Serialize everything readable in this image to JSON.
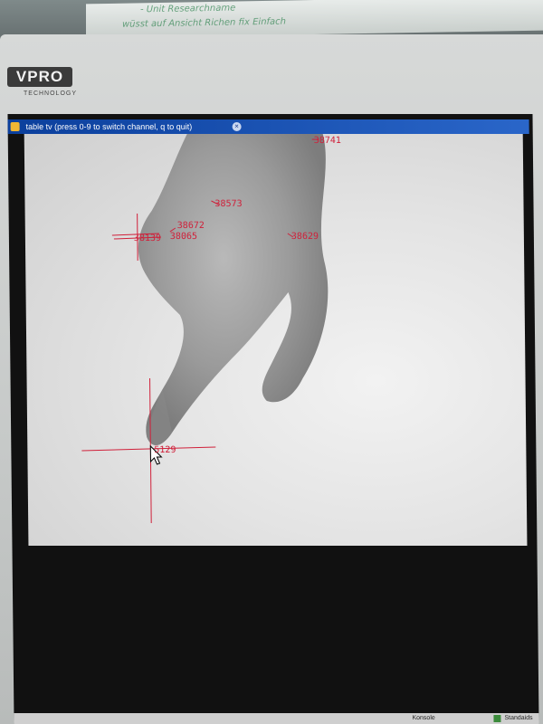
{
  "whiteboard": {
    "line1": "- Unit Researchname",
    "line2": "wüsst  auf Ansicht Richen fix Einfach"
  },
  "monitor": {
    "brand": "VPRO",
    "brand_sub": "TECHNOLOGY"
  },
  "window": {
    "title": "table tv (press 0-9 to switch channel, q to quit)"
  },
  "tracking": {
    "labels": {
      "l1": "38741",
      "l2": "38573",
      "l3": "38672",
      "l4": "38139",
      "l5": "38065",
      "l6": "38629",
      "l7": "5129"
    }
  },
  "taskbar": {
    "item1": "Konsole",
    "item2": "Standaids"
  },
  "colors": {
    "marker": "#d0203a",
    "titlebar": "#0b3f9c"
  }
}
